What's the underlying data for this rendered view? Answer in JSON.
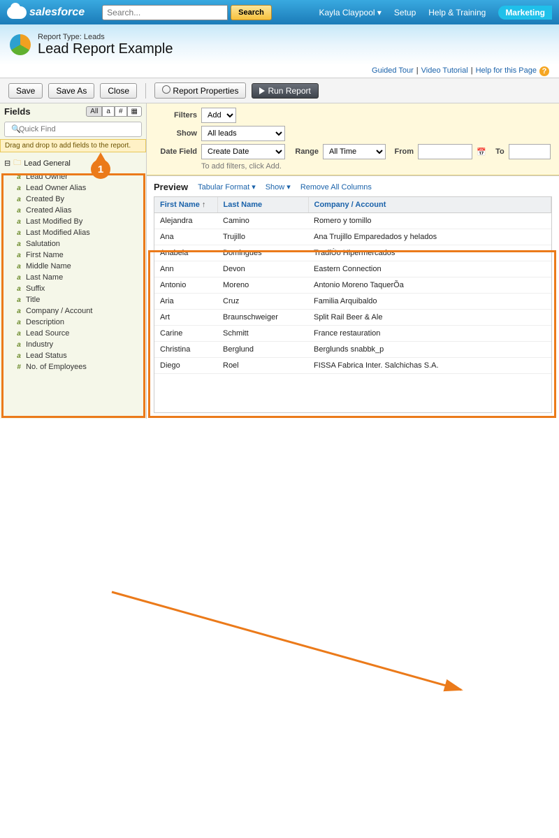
{
  "brand": "salesforce",
  "search": {
    "placeholder": "Search...",
    "button": "Search"
  },
  "topnav": {
    "user": "Kayla Claypool",
    "setup": "Setup",
    "help": "Help & Training",
    "market": "Marketing"
  },
  "report": {
    "type_label": "Report Type: Leads",
    "title": "Lead Report Example"
  },
  "helplinks": {
    "guided": "Guided Tour",
    "video": "Video Tutorial",
    "page": "Help for this Page"
  },
  "toolbar": {
    "save": "Save",
    "saveas": "Save As",
    "close": "Close",
    "props": "Report Properties",
    "run": "Run Report"
  },
  "fields": {
    "heading": "Fields",
    "tabs": {
      "all": "All",
      "a": "a",
      "hash": "#",
      "grid": "▦"
    },
    "quickfind_placeholder": "Quick Find",
    "draghint": "Drag and drop to add fields to the report.",
    "group": "Lead General",
    "items": [
      "Lead Owner",
      "Lead Owner Alias",
      "Created By",
      "Created Alias",
      "Last Modified By",
      "Last Modified Alias",
      "Salutation",
      "First Name",
      "Middle Name",
      "Last Name",
      "Suffix",
      "Title",
      "Company / Account",
      "Description",
      "Lead Source",
      "Industry",
      "Lead Status",
      "No. of Employees"
    ]
  },
  "filters": {
    "filters_label": "Filters",
    "add": "Add",
    "show_label": "Show",
    "show_value": "All leads",
    "date_label": "Date Field",
    "date_value": "Create Date",
    "range_label": "Range",
    "range_value": "All Time",
    "from_label": "From",
    "to_label": "To",
    "addhint": "To add filters, click Add."
  },
  "preview": {
    "heading": "Preview",
    "format": "Tabular Format",
    "show": "Show",
    "removeall": "Remove All Columns",
    "cols": {
      "first": "First Name",
      "last": "Last Name",
      "company": "Company / Account"
    },
    "rows": [
      {
        "first": "Alejandra",
        "last": "Camino",
        "company": "Romero y tomillo"
      },
      {
        "first": "Ana",
        "last": "Trujillo",
        "company": "Ana Trujillo Emparedados y helados"
      },
      {
        "first": "Anabela",
        "last": "Domingues",
        "company": "TradiÙo Hipermercados"
      },
      {
        "first": "Ann",
        "last": "Devon",
        "company": "Eastern Connection"
      },
      {
        "first": "Antonio",
        "last": "Moreno",
        "company": "Antonio Moreno TaquerÕa"
      },
      {
        "first": "Aria",
        "last": "Cruz",
        "company": "Familia Arquibaldo"
      },
      {
        "first": "Art",
        "last": "Braunschweiger",
        "company": "Split Rail Beer & Ale"
      },
      {
        "first": "Carine",
        "last": "Schmitt",
        "company": "France restauration"
      },
      {
        "first": "Christina",
        "last": "Berglund",
        "company": "Berglunds snabbk_p"
      },
      {
        "first": "Diego",
        "last": "Roel",
        "company": "FISSA Fabrica Inter. Salchichas S.A."
      }
    ]
  },
  "annot": {
    "step1": "1"
  }
}
